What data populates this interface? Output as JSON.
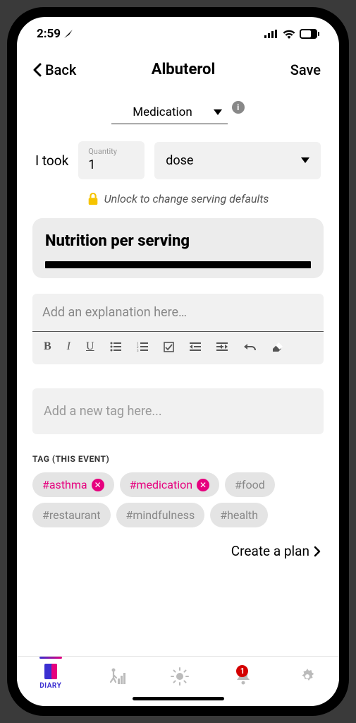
{
  "status": {
    "time": "2:59",
    "battery": "63"
  },
  "nav": {
    "back": "Back",
    "title": "Albuterol",
    "save": "Save"
  },
  "category": {
    "value": "Medication"
  },
  "intake": {
    "prefix": "I took",
    "quantity_label": "Quantity",
    "quantity_value": "1",
    "unit": "dose"
  },
  "unlock_hint": "Unlock to change serving defaults",
  "nutrition": {
    "title": "Nutrition per serving"
  },
  "explanation_placeholder": "Add an explanation here…",
  "tag_input_placeholder": "Add a new tag here...",
  "tag_section_label": "TAG (THIS EVENT)",
  "tags": {
    "t0": "#asthma",
    "t1": "#medication",
    "t2": "#food",
    "t3": "#restaurant",
    "t4": "#mindfulness",
    "t5": "#health"
  },
  "create_plan": "Create a plan",
  "tabs": {
    "diary": "DIARY",
    "notif_count": "1"
  }
}
